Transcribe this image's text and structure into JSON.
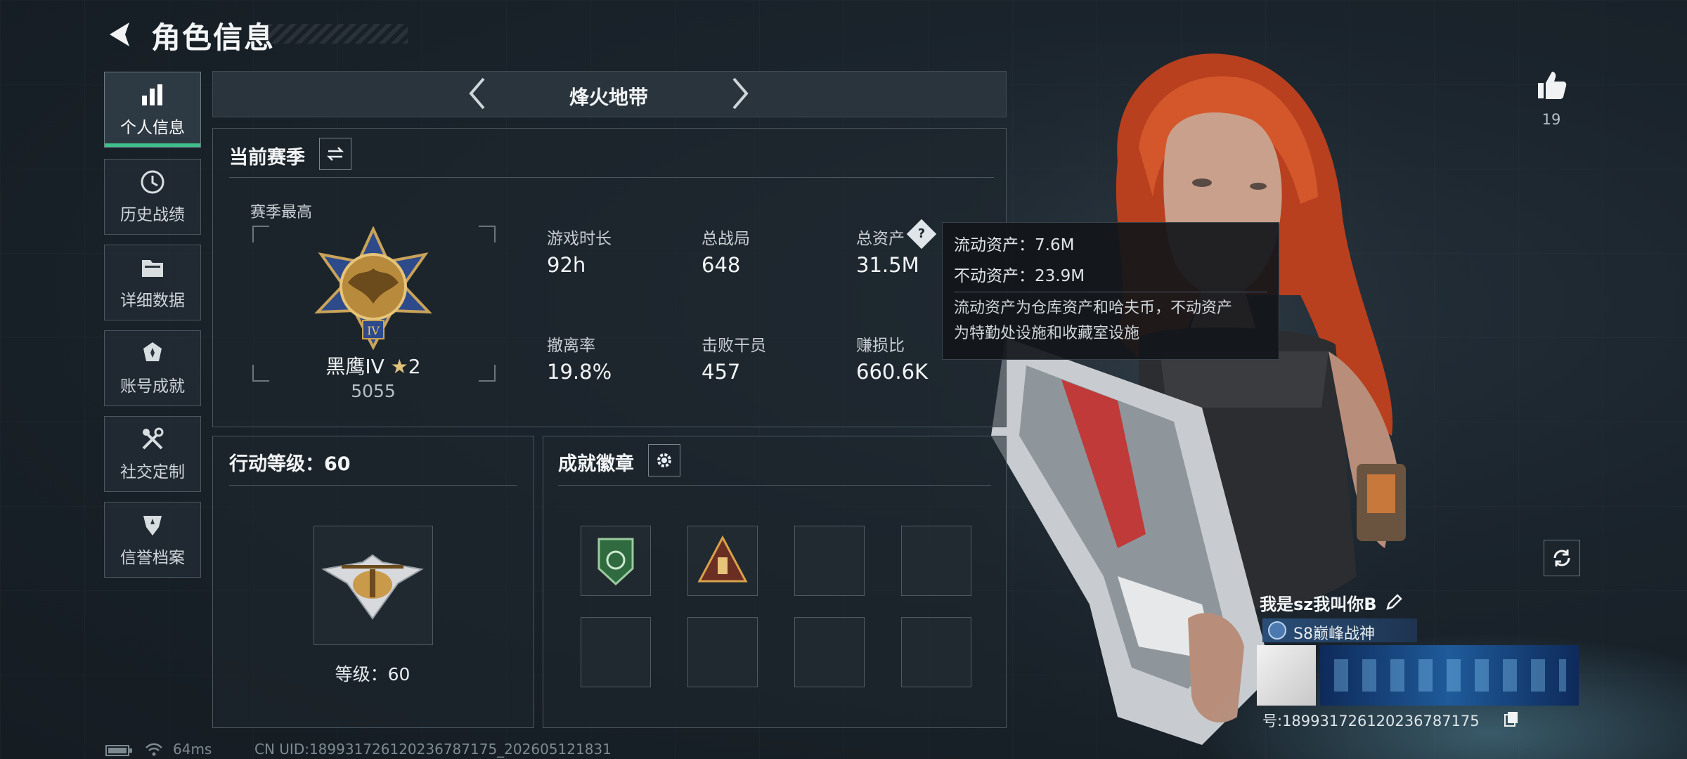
{
  "header": {
    "title": "角色信息"
  },
  "sidebar": {
    "items": [
      {
        "label": "个人信息",
        "icon": "bar-chart-icon"
      },
      {
        "label": "历史战绩",
        "icon": "history-icon"
      },
      {
        "label": "详细数据",
        "icon": "folder-icon"
      },
      {
        "label": "账号成就",
        "icon": "achievement-icon"
      },
      {
        "label": "社交定制",
        "icon": "tools-icon"
      },
      {
        "label": "信誉档案",
        "icon": "shield-icon"
      }
    ]
  },
  "mode_nav": {
    "label": "烽火地带"
  },
  "season": {
    "title": "当前赛季",
    "best_label": "赛季最高",
    "rank_name": "黑鹰IV",
    "rank_stars": "2",
    "rank_score": "5055",
    "stats": [
      {
        "label": "游戏时长",
        "value": "92h"
      },
      {
        "label": "总战局",
        "value": "648"
      },
      {
        "label": "总资产",
        "value": "31.5M"
      },
      {
        "label": "撤离率",
        "value": "19.8%"
      },
      {
        "label": "击败干员",
        "value": "457"
      },
      {
        "label": "赚损比",
        "value": "660.6K"
      }
    ]
  },
  "tooltip": {
    "liquid": "流动资产：7.6M",
    "fixed": "不动资产：23.9M",
    "desc_1": "流动资产为仓库资产和哈夫币，不动资产",
    "desc_2": "为特勤处设施和收藏室设施"
  },
  "action_level": {
    "title": "行动等级：60",
    "level_text": "等级：60"
  },
  "badges": {
    "title": "成就徽章",
    "slots": 8,
    "filled": 2
  },
  "likes": {
    "count": "19"
  },
  "profile": {
    "name": "我是sz我叫你B",
    "title_badge": "S8巅峰战神",
    "uid_line": "号:18993172612023678717​5"
  },
  "footer": {
    "ping": "64ms",
    "uid": "CN UID:18993172612023678717​5_202605121831"
  },
  "colors": {
    "accent": "#3fbf8c",
    "panel_border": "#4a5660",
    "hair": "#c2452a"
  }
}
